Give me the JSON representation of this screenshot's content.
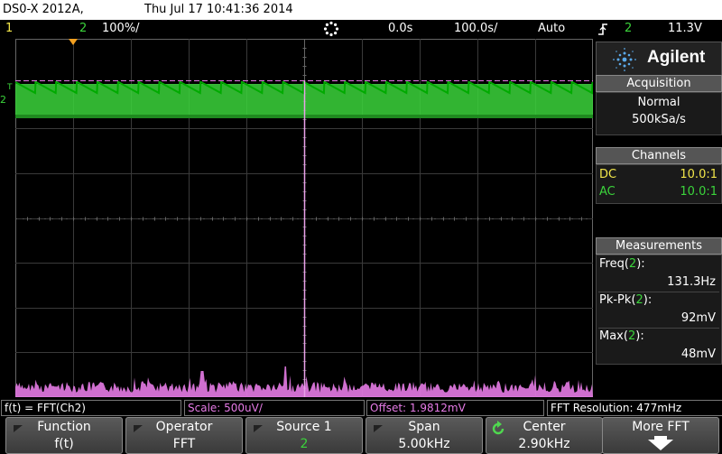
{
  "topbar": {
    "model": "DS0-X 2012A,",
    "datetime": "Thu Jul 17 10:41:36 2014"
  },
  "statusbar": {
    "ch1_label": "1",
    "ch2_label": "2",
    "ch2_scale": "100%/",
    "horiz_delay": "0.0s",
    "time_scale": "100.0s/",
    "trigger_mode": "Auto",
    "trigger_icon": "trigger-edge-icon",
    "trigger_source": "2",
    "trigger_level": "11.3V",
    "run_icon": "acquisition-status-icon"
  },
  "side_panel": {
    "brand": "Agilent",
    "logo_icon": "agilent-spark-logo",
    "acquisition": {
      "header": "Acquisition",
      "mode": "Normal",
      "rate": "500kSa/s"
    },
    "channels": {
      "header": "Channels",
      "rows": [
        {
          "coupling": "DC",
          "probe": "10.0:1"
        },
        {
          "coupling": "AC",
          "probe": "10.0:1"
        }
      ]
    },
    "measurements": {
      "header": "Measurements",
      "items": [
        {
          "name": "Freq",
          "channel": "2",
          "value": "131.3Hz"
        },
        {
          "name": "Pk-Pk",
          "channel": "2",
          "value": "92mV"
        },
        {
          "name": "Max",
          "channel": "2",
          "value": "48mV"
        }
      ]
    }
  },
  "waveform_markers": {
    "channel_marker": "2",
    "trigger_marker": "T"
  },
  "annotation_bar": {
    "function": "f(t) = FFT(Ch2)",
    "scale": "Scale: 500uV/",
    "offset": "Offset: 1.9812mV",
    "resolution": "FFT Resolution: 477mHz"
  },
  "softkeys": [
    {
      "label": "Function",
      "value": "f(t)"
    },
    {
      "label": "Operator",
      "value": "FFT"
    },
    {
      "label": "Source 1",
      "value": "2"
    },
    {
      "label": "Span",
      "value": "5.00kHz"
    },
    {
      "label": "Center",
      "value": "2.90kHz",
      "icon": "rotate-knob-icon"
    },
    {
      "label": "More FFT",
      "icon": "down-arrow-icon"
    }
  ],
  "colors": {
    "ch1": "#f2e64a",
    "ch2": "#3bd43b",
    "math": "#e67be6",
    "grid": "#3a3a3a",
    "brand_accent": "#5aa8e8"
  }
}
